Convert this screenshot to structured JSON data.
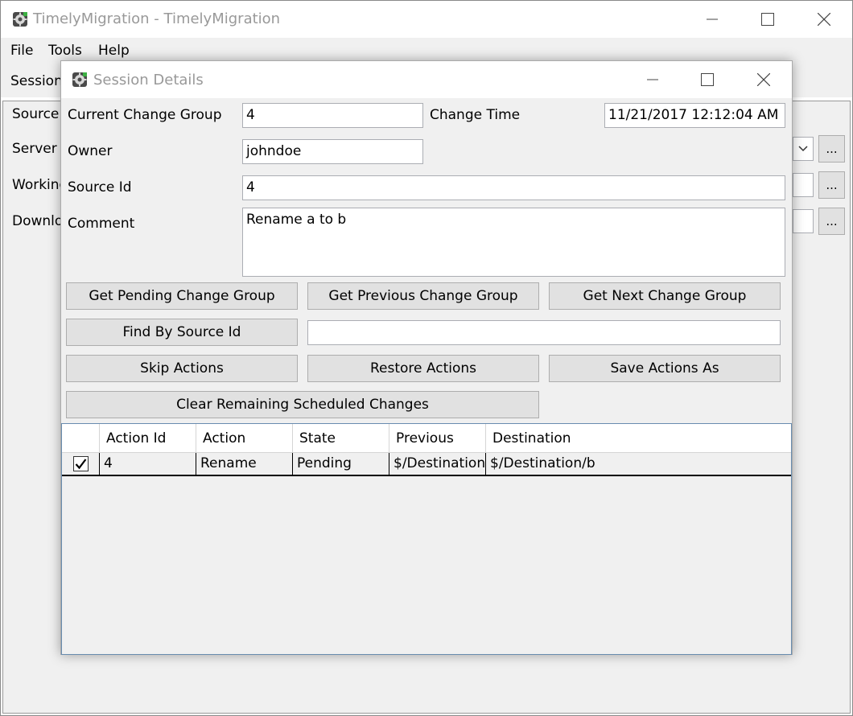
{
  "main_window": {
    "title": "TimelyMigration - TimelyMigration",
    "menu": [
      "File",
      "Tools",
      "Help"
    ],
    "toolbar_tab": "Session",
    "background_labels": [
      "Source",
      "Server",
      "Working",
      "Downlo"
    ],
    "browse_label": "..."
  },
  "dialog": {
    "title": "Session Details",
    "current_change_group_label": "Current Change Group",
    "current_change_group_value": "4",
    "change_time_label": "Change Time",
    "change_time_value": "11/21/2017 12:12:04 AM",
    "owner_label": "Owner",
    "owner_value": "johndoe",
    "source_id_label": "Source Id",
    "source_id_value": "4",
    "comment_label": "Comment",
    "comment_value": "Rename a to b",
    "buttons": {
      "get_pending": "Get Pending Change Group",
      "get_previous": "Get Previous Change Group",
      "get_next": "Get Next Change Group",
      "find_by_source_id": "Find By Source Id",
      "skip_actions": "Skip Actions",
      "restore_actions": "Restore Actions",
      "save_actions_as": "Save Actions As",
      "clear_remaining": "Clear Remaining Scheduled Changes"
    },
    "find_input_value": "",
    "grid": {
      "columns": [
        "Action Id",
        "Action",
        "State",
        "Previous",
        "Destination"
      ],
      "rows": [
        {
          "checked": true,
          "action_id": "4",
          "action": "Rename",
          "state": "Pending",
          "previous": "$/Destination,",
          "destination": "$/Destination/b"
        }
      ]
    }
  },
  "colors": {
    "window_bg": "#f0f0f0",
    "button_bg": "#e1e1e1",
    "title_gray": "#999999",
    "grid_border": "#688caf"
  }
}
